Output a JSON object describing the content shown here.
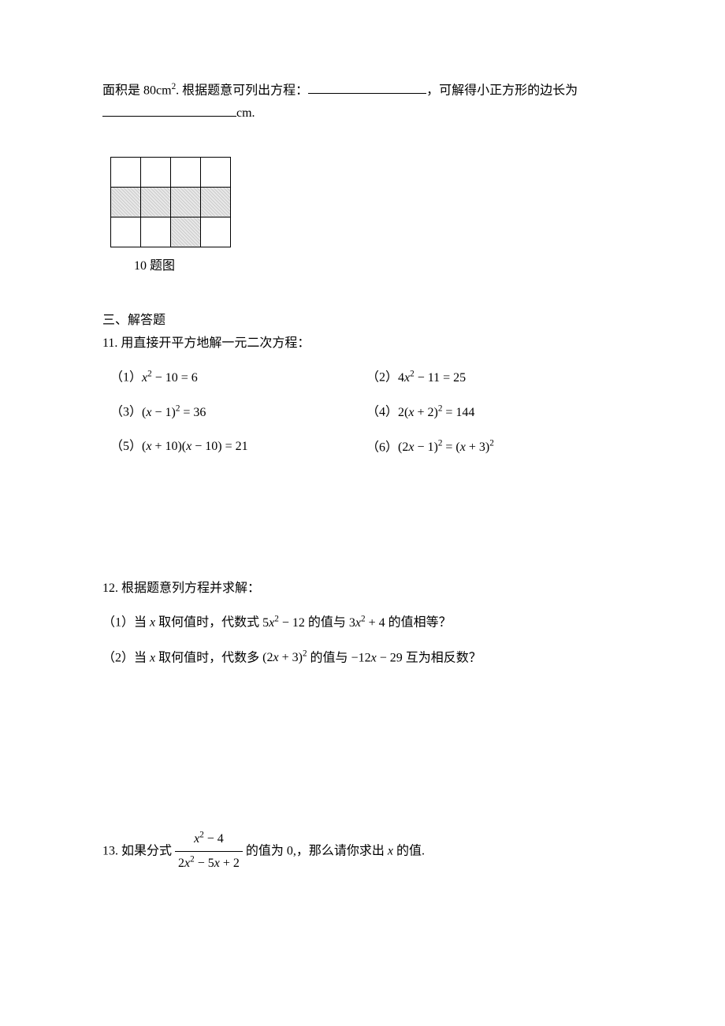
{
  "q10": {
    "pre_text": "面积是 80cm",
    "sup": "2",
    "post_text": ". 根据题意可列出方程：",
    "tail_text": "，可解得小正方形的边长为",
    "unit": "cm.",
    "caption": "10 题图"
  },
  "sections": {
    "s3": "三、解答题"
  },
  "q11": {
    "prompt": "11. 用直接开平方地解一元二次方程：",
    "p1_label": "（1）",
    "p1_expr": "x² − 10 = 6",
    "p2_label": "（2）",
    "p2_expr": "4x² − 11 = 25",
    "p3_label": "（3）",
    "p3_expr": "(x − 1)² = 36",
    "p4_label": "（4）",
    "p4_expr": "2(x + 2)² = 144",
    "p5_label": "（5）",
    "p5_expr": "(x + 10)(x − 10) = 21",
    "p6_label": "（6）",
    "p6_expr": "(2x − 1)² = (x + 3)²"
  },
  "q12": {
    "prompt": "12. 根据题意列方程并求解：",
    "p1_label": "（1）当 ",
    "p1_var": "x",
    "p1_t1": " 取何值时，代数式 ",
    "p1_e1": "5x² − 12",
    "p1_t2": " 的值与 ",
    "p1_e2": "3x² + 4",
    "p1_t3": " 的值相等？",
    "p2_label": "（2）当 ",
    "p2_var": "x",
    "p2_t1": " 取何值时，代数多 ",
    "p2_e1": "(2x + 3)²",
    "p2_t2": " 的值与 ",
    "p2_e2": "−12x − 29",
    "p2_t3": " 互为相反数？"
  },
  "q13": {
    "pre": "13. 如果分式 ",
    "num": "x² − 4",
    "den": "2x² − 5x + 2",
    "mid": " 的值为 0,，那么请你求出 ",
    "var": "x",
    "tail": " 的值."
  }
}
